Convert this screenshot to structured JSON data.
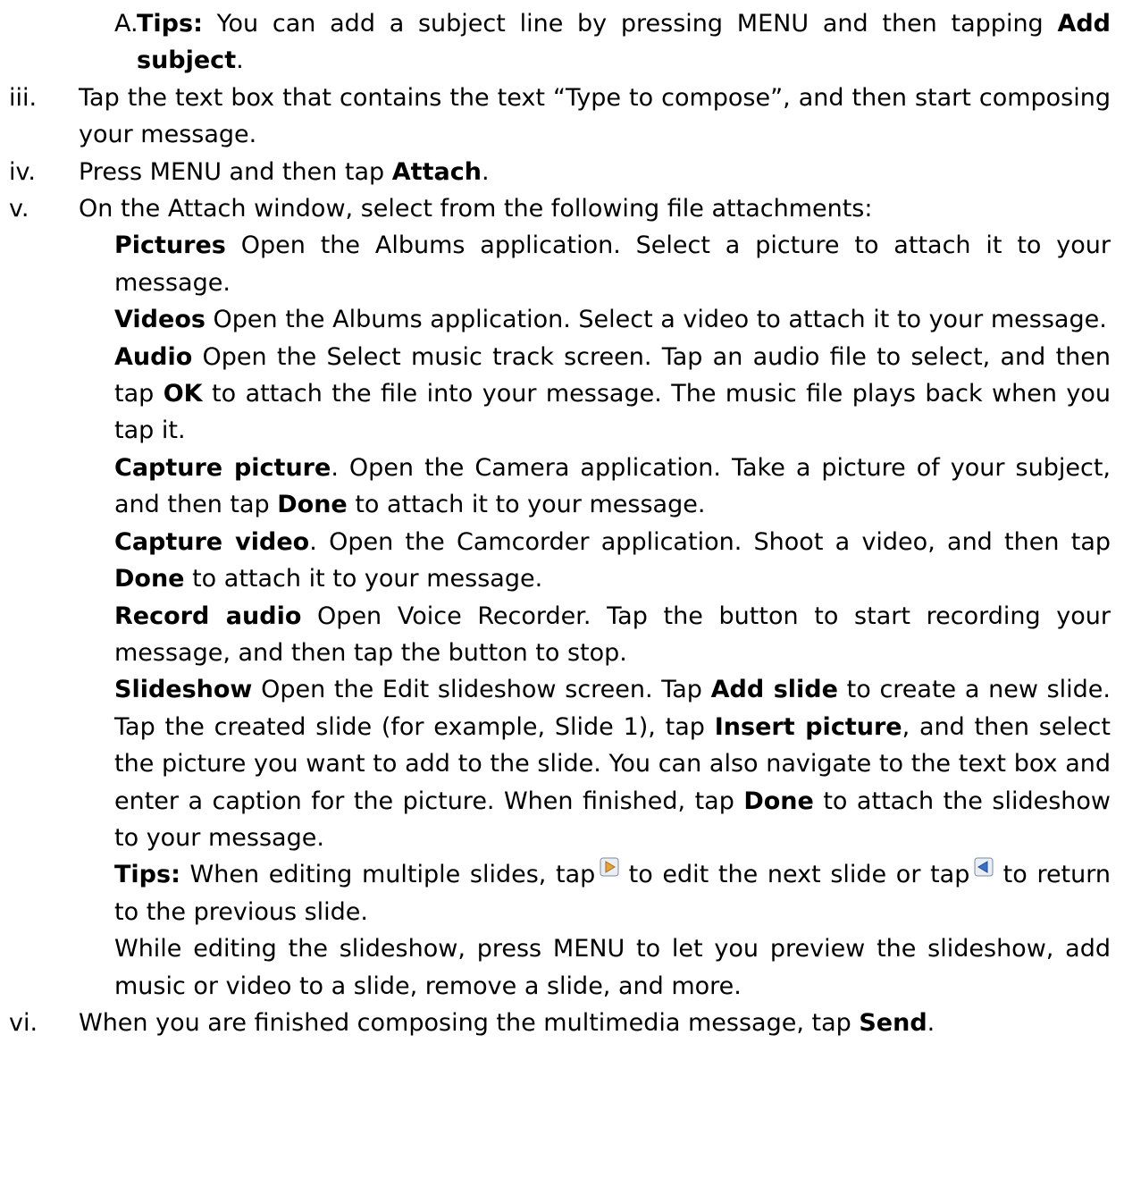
{
  "steps": {
    "A": {
      "num": "A.",
      "tips_label": "Tips:",
      "text1": " You can add a subject line by pressing MENU and then tapping ",
      "bold1": "Add subject",
      "text2": "."
    },
    "iii": {
      "num": "iii.",
      "text": "Tap the text box that contains the text “Type to compose”, and then start composing your message."
    },
    "iv": {
      "num": "iv.",
      "text1": "Press MENU and then tap ",
      "bold1": "Attach",
      "text2": "."
    },
    "v": {
      "num": "v.",
      "text": "On the Attach window, select from the following file attachments:"
    },
    "vi": {
      "num": "vi.",
      "text1": "When you are finished composing the multimedia message, tap ",
      "bold1": "Send",
      "text2": "."
    }
  },
  "attachments": {
    "pictures": {
      "label": "Pictures",
      "text": " Open the Albums application. Select a picture to attach it to your message."
    },
    "videos": {
      "label": "Videos",
      "text": " Open the Albums application. Select a video to attach it to your message."
    },
    "audio": {
      "label": "Audio",
      "text1": " Open the Select music track screen. Tap an audio file to select, and then tap ",
      "bold1": "OK",
      "text2": " to attach the file into your message. The music file plays back when you tap it."
    },
    "capture_picture": {
      "label": "Capture picture",
      "text1": ". Open the Camera application. Take a picture of your subject, and then tap ",
      "bold1": "Done",
      "text2": " to attach it to your message."
    },
    "capture_video": {
      "label": "Capture video",
      "text1": ". Open the Camcorder application. Shoot a video, and then tap ",
      "bold1": "Done",
      "text2": " to attach it to your message."
    },
    "record_audio": {
      "label": "Record audio",
      "text": " Open Voice Recorder. Tap the button to start recording your message, and then tap the button to stop."
    },
    "slideshow": {
      "label": "Slideshow",
      "text1": " Open the Edit slideshow screen. Tap ",
      "bold1": "Add slide",
      "text2": " to create a new slide. Tap the created slide (for example, Slide 1), tap ",
      "bold2": "Insert picture",
      "text3": ", and then select the picture you want to add to the slide. You can also navigate to the text box and enter a caption for the picture. When finished, tap ",
      "bold3": "Done",
      "text4": " to attach the slideshow to your message."
    },
    "slideshow_tips": {
      "label": "Tips:",
      "text1": " When editing multiple slides, tap ",
      "text2": " to edit the next slide or tap ",
      "text3": " to return to the previous slide.",
      "next_icon": "next-slide-icon",
      "prev_icon": "previous-slide-icon"
    },
    "slideshow_menu": {
      "text": "While editing the slideshow, press MENU to let you preview the slideshow, add music or video to a slide, remove a slide, and more."
    }
  }
}
